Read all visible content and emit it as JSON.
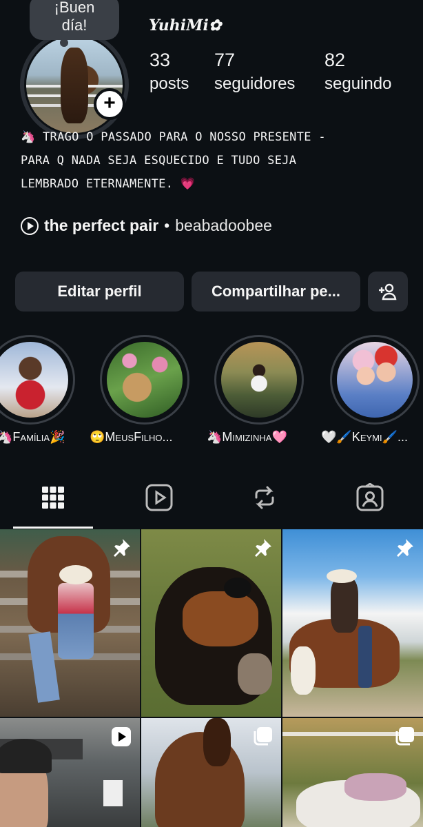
{
  "note": "¡Buen día!",
  "profile": {
    "username": "YuhiMi✿",
    "stats": [
      {
        "value": "33",
        "label": "posts"
      },
      {
        "value": "77",
        "label": "seguidores"
      },
      {
        "value": "82",
        "label": "seguindo"
      }
    ],
    "bio": "🦄 TRAGO O PASSADO PARA O NOSSO PRESENTE -\nPARA Q NADA SEJA ESQUECIDO E TUDO SEJA\nLEMBRADO ETERNAMENTE. 💗",
    "music": {
      "song": "the perfect pair",
      "artist": "beabadoobee",
      "separator": "•"
    }
  },
  "buttons": {
    "edit": "Editar perfil",
    "share": "Compartilhar pe..."
  },
  "highlights": [
    {
      "label": "🦄Família🎉"
    },
    {
      "label": "🙄MeusFilho..."
    },
    {
      "label": "🦄Mimizinha🩷"
    },
    {
      "label": "🤍🖌️Keymi🖌️..."
    }
  ],
  "tabs": [
    "grid-icon",
    "reels-icon",
    "reposts-icon",
    "tagged-icon"
  ],
  "posts": [
    {
      "badge": "pin-icon"
    },
    {
      "badge": "pin-icon"
    },
    {
      "badge": "pin-icon"
    },
    {
      "badge": "reel-icon"
    },
    {
      "badge": "carousel-icon"
    },
    {
      "badge": "carousel-icon"
    }
  ],
  "colors": {
    "background": "#0c1014",
    "button": "#262a31",
    "text": "#f5f5f5"
  }
}
